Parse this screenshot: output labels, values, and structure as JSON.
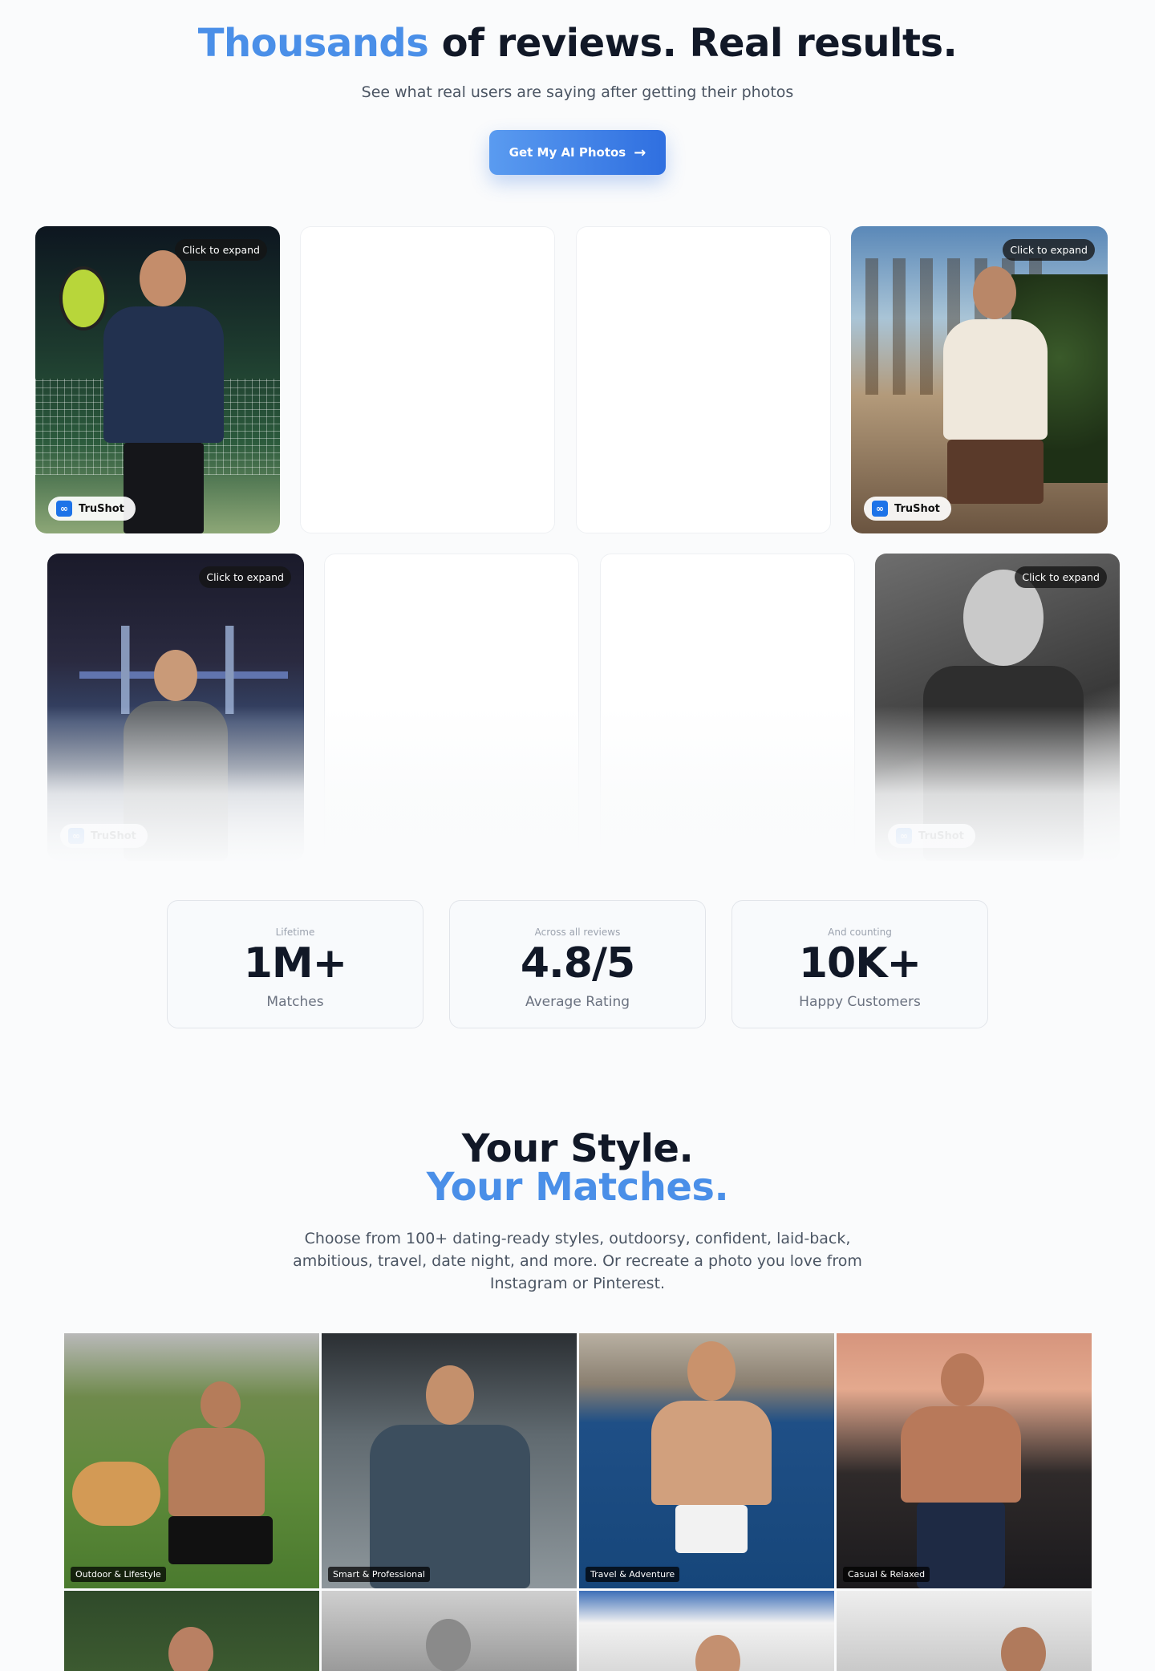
{
  "hero": {
    "title_accent": "Thousands",
    "title_rest": "of reviews. Real results.",
    "subtitle": "See what real users are saying after getting their photos",
    "cta_label": "Get My AI Photos"
  },
  "reviews": {
    "expand_label": "Click to expand",
    "brand_name": "TruShot"
  },
  "stats": [
    {
      "caption": "Lifetime",
      "value": "1M+",
      "label": "Matches"
    },
    {
      "caption": "Across all reviews",
      "value": "4.8/5",
      "label": "Average Rating"
    },
    {
      "caption": "And counting",
      "value": "10K+",
      "label": "Happy Customers"
    }
  ],
  "styles_section": {
    "title_line1": "Your Style.",
    "title_line2": "Your Matches.",
    "description": "Choose from 100+ dating-ready styles, outdoorsy, confident, laid-back, ambitious, travel, date night, and more. Or recreate a photo you love from Instagram or Pinterest.",
    "tiles": [
      {
        "label": "Outdoor & Lifestyle"
      },
      {
        "label": "Smart & Professional"
      },
      {
        "label": "Travel & Adventure"
      },
      {
        "label": "Casual & Relaxed"
      }
    ]
  },
  "colors": {
    "accent": "#4a8fe8",
    "cta_start": "#5a9bf0",
    "cta_end": "#2f6fe0",
    "heading": "#111827",
    "muted": "#6b7280"
  },
  "icons": {
    "cta_icon": "arrow-right-icon",
    "brand_icon": "trushot-logo-icon"
  }
}
